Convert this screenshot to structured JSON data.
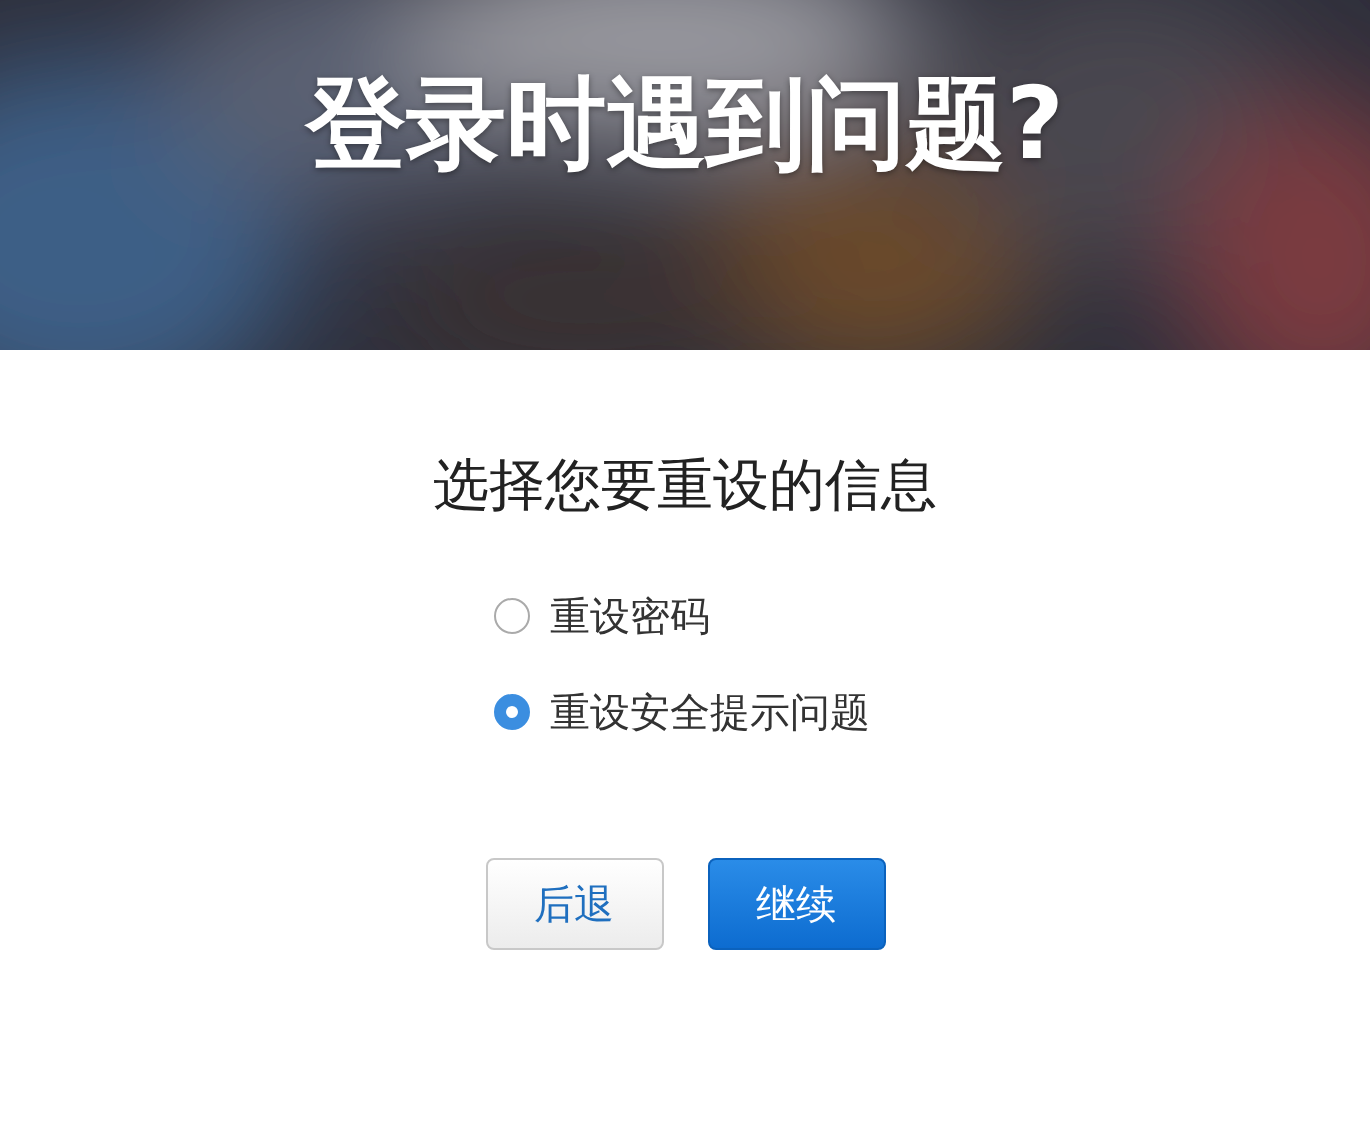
{
  "header": {
    "title": "登录时遇到问题?"
  },
  "heading": "选择您要重设的信息",
  "options": [
    {
      "label": "重设密码",
      "selected": false
    },
    {
      "label": "重设安全提示问题",
      "selected": true
    }
  ],
  "buttons": [
    {
      "label": "后退",
      "kind": "secondary"
    },
    {
      "label": "继续",
      "kind": "primary"
    }
  ]
}
